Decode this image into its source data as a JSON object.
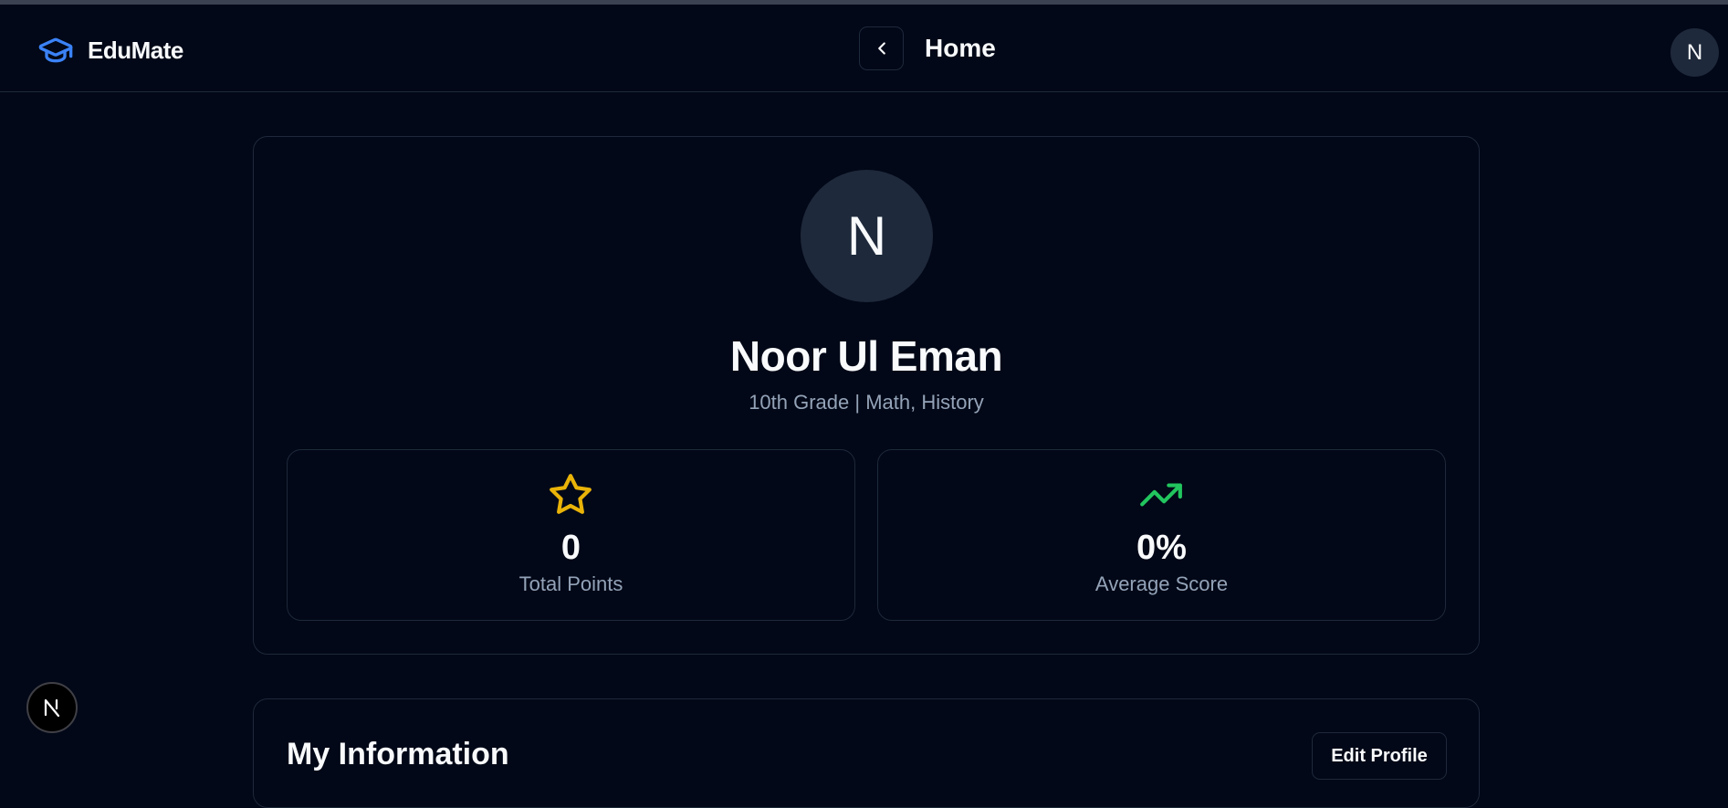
{
  "app": {
    "name": "EduMate"
  },
  "header": {
    "title": "Home",
    "avatar_initial": "N"
  },
  "profile": {
    "avatar_initial": "N",
    "name": "Noor Ul Eman",
    "subtitle": "10th Grade | Math, History"
  },
  "stats": [
    {
      "value": "0",
      "label": "Total Points",
      "icon": "star-icon",
      "color": "#eab308"
    },
    {
      "value": "0%",
      "label": "Average Score",
      "icon": "trending-up-icon",
      "color": "#22c55e"
    }
  ],
  "info_section": {
    "title": "My Information",
    "edit_label": "Edit Profile"
  },
  "dev_badge": {
    "icon": "next-logo-icon"
  },
  "colors": {
    "background": "#020817",
    "border": "#1e293b",
    "accent": "#3b82f6",
    "muted_text": "#94a3b8"
  }
}
